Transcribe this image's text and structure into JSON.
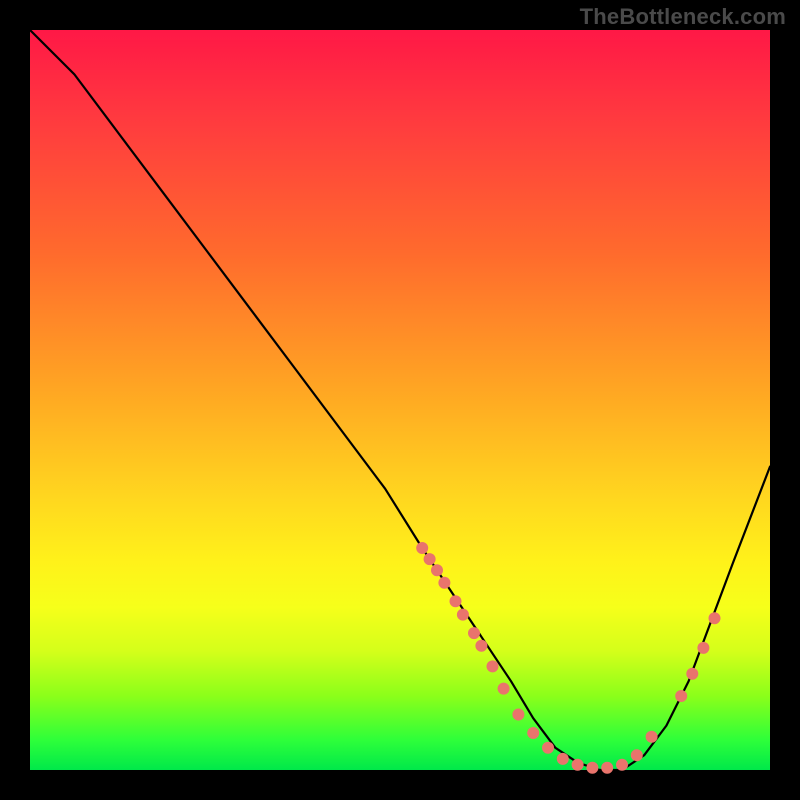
{
  "watermark": "TheBottleneck.com",
  "chart_data": {
    "type": "line",
    "title": "",
    "xlabel": "",
    "ylabel": "",
    "xlim": [
      0,
      100
    ],
    "ylim": [
      0,
      100
    ],
    "grid": false,
    "series": [
      {
        "name": "curve",
        "x": [
          0,
          6,
          12,
          18,
          24,
          30,
          36,
          42,
          48,
          53,
          57,
          61,
          65,
          68,
          71,
          74,
          77,
          80,
          83,
          86,
          89,
          92,
          95,
          100
        ],
        "y": [
          100,
          94,
          86,
          78,
          70,
          62,
          54,
          46,
          38,
          30,
          24,
          18,
          12,
          7,
          3,
          1,
          0,
          0,
          2,
          6,
          12,
          20,
          28,
          41
        ]
      }
    ],
    "markers": [
      {
        "x": 53.0,
        "y": 30.0
      },
      {
        "x": 54.0,
        "y": 28.5
      },
      {
        "x": 55.0,
        "y": 27.0
      },
      {
        "x": 56.0,
        "y": 25.3
      },
      {
        "x": 57.5,
        "y": 22.8
      },
      {
        "x": 58.5,
        "y": 21.0
      },
      {
        "x": 60.0,
        "y": 18.5
      },
      {
        "x": 61.0,
        "y": 16.8
      },
      {
        "x": 62.5,
        "y": 14.0
      },
      {
        "x": 64.0,
        "y": 11.0
      },
      {
        "x": 66.0,
        "y": 7.5
      },
      {
        "x": 68.0,
        "y": 5.0
      },
      {
        "x": 70.0,
        "y": 3.0
      },
      {
        "x": 72.0,
        "y": 1.5
      },
      {
        "x": 74.0,
        "y": 0.7
      },
      {
        "x": 76.0,
        "y": 0.3
      },
      {
        "x": 78.0,
        "y": 0.3
      },
      {
        "x": 80.0,
        "y": 0.7
      },
      {
        "x": 82.0,
        "y": 2.0
      },
      {
        "x": 84.0,
        "y": 4.5
      },
      {
        "x": 88.0,
        "y": 10.0
      },
      {
        "x": 89.5,
        "y": 13.0
      },
      {
        "x": 91.0,
        "y": 16.5
      },
      {
        "x": 92.5,
        "y": 20.5
      }
    ],
    "marker_color": "#e9746c",
    "curve_color": "#000000"
  }
}
